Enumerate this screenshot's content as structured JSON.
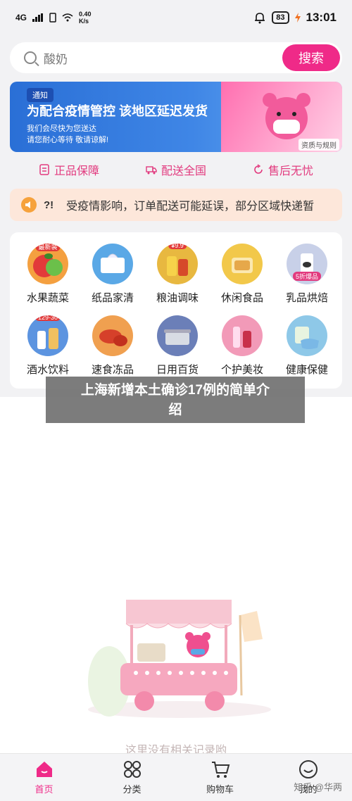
{
  "status_bar": {
    "signal": "4G",
    "speed_value": "0.40",
    "speed_unit": "K/s",
    "battery": "83",
    "time": "13:01"
  },
  "search": {
    "placeholder": "酸奶",
    "button_label": "搜索"
  },
  "banner": {
    "tag": "通知",
    "title": "为配合疫情管控 该地区延迟发货",
    "line1": "我们会尽快为您送达",
    "line2": "请您耐心等待 敬请谅解!",
    "rules_label": "资质与规则"
  },
  "guarantees": [
    {
      "label": "正品保障",
      "icon": "shield-doc-icon"
    },
    {
      "label": "配送全国",
      "icon": "truck-icon"
    },
    {
      "label": "售后无忧",
      "icon": "refresh-icon"
    }
  ],
  "notice": {
    "prefix": "?!",
    "text": "受疫情影响，订单配送可能延误，部分区域快递暂"
  },
  "categories": [
    {
      "label": "水果蔬菜",
      "badge": "最新装",
      "color": "#f4a040"
    },
    {
      "label": "纸品家清",
      "badge": "",
      "color": "#5aa8e6"
    },
    {
      "label": "粮油调味",
      "badge": "¥9.9",
      "color": "#e8b840"
    },
    {
      "label": "休闲食品",
      "badge": "",
      "color": "#f2c84a"
    },
    {
      "label": "乳品烘焙",
      "badge": "5折爆品",
      "color": "#c8d0e8"
    },
    {
      "label": "酒水饮料",
      "badge": "129-30",
      "color": "#5c94e0"
    },
    {
      "label": "速食冻品",
      "badge": "",
      "color": "#f0a050"
    },
    {
      "label": "日用百货",
      "badge": "",
      "color": "#6b7fb8"
    },
    {
      "label": "个护美妆",
      "badge": "",
      "color": "#f29ab8"
    },
    {
      "label": "健康保健",
      "badge": "",
      "color": "#8ec8e8"
    }
  ],
  "overlay": {
    "line1": "上海新增本土确诊17例的简单介",
    "line2": "绍"
  },
  "empty": {
    "text": "这里没有相关记录哟"
  },
  "tabs": [
    {
      "label": "首页",
      "icon": "home-icon"
    },
    {
      "label": "分类",
      "icon": "grid-icon"
    },
    {
      "label": "购物车",
      "icon": "cart-icon"
    },
    {
      "label": "我的",
      "icon": "smile-icon"
    }
  ],
  "watermark": "知乎 @华两",
  "colors": {
    "accent": "#ef2a88",
    "banner_blue": "#2a6fd6",
    "notice_bg": "#fde7da"
  }
}
